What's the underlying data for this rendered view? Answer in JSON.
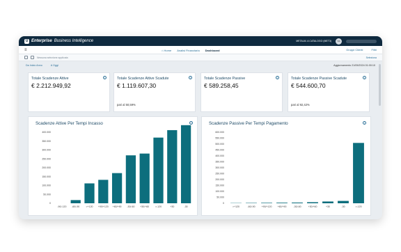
{
  "app": {
    "brand_bold": "Enterprise",
    "brand_rest": "Business Intelligence",
    "logo_letter": "U",
    "catalog": "METALM. A CATALOGO (MET3)",
    "avatar_initials": "SS"
  },
  "nav": {
    "menu_icon": "hamburger-icon",
    "crumbs": [
      "Home",
      "Analisi Finanziaria",
      "Dashboard"
    ],
    "right": [
      "Gruppi Clienti",
      "Filtri"
    ]
  },
  "filters": {
    "placeholder": "Nessuna selezione applicata",
    "reset_label": "Seleziona"
  },
  "dates": {
    "from_label": "Da Inizio Anno",
    "to_label": "A Oggi",
    "updated": "Aggiornamento 21/05/2024 01:00:10"
  },
  "kpis": [
    {
      "title": "Totale Scadenze Attive",
      "value": "€ 2.212.949,92",
      "note": ""
    },
    {
      "title": "Totale Scadenze Attive Scadute",
      "value": "€ 1.119.607,30",
      "note": "pari al 50,59%"
    },
    {
      "title": "Totale Scadenze Passive",
      "value": "€ 589.258,45",
      "note": ""
    },
    {
      "title": "Totale Scadenze Passive Scadute",
      "value": "€ 544.600,70",
      "note": "pari al 92,42%"
    }
  ],
  "colors": {
    "bar": "#0d6e7d",
    "header": "#0f2a3f"
  },
  "chart_data": [
    {
      "type": "bar",
      "title": "Scadenze Attive Per Tempi Incasso",
      "categories": [
        "-90/-120",
        "-60/-90",
        ">+120",
        "+90/+120",
        "+60/+90",
        "-30/-60",
        "+30/+60",
        ">-120",
        "+30",
        "-30"
      ],
      "values": [
        0,
        18000,
        112000,
        132000,
        170000,
        270000,
        280000,
        370000,
        412000,
        440000
      ],
      "ylim": [
        0,
        400000
      ],
      "yticks": [
        "0",
        "50.000",
        "100.000",
        "150.000",
        "200.000",
        "250.000",
        "300.000",
        "350.000",
        "400.000"
      ],
      "xlabel": "",
      "ylabel": ""
    },
    {
      "type": "bar",
      "title": "Scadenze Passive Per Tempi Pagamento",
      "categories": [
        ">+120",
        "-60/-90",
        "+90/+120",
        "+60/+90",
        "-30/-60",
        "+30/+60",
        "+30",
        "-30",
        ">-120"
      ],
      "values": [
        2000,
        3000,
        4000,
        5000,
        6000,
        9000,
        15000,
        20000,
        510000
      ],
      "ylim": [
        0,
        600000
      ],
      "yticks": [
        "0",
        "50.000",
        "100.000",
        "150.000",
        "200.000",
        "250.000",
        "300.000",
        "350.000",
        "400.000",
        "450.000",
        "500.000",
        "550.000",
        "600.000"
      ],
      "xlabel": "",
      "ylabel": ""
    }
  ]
}
